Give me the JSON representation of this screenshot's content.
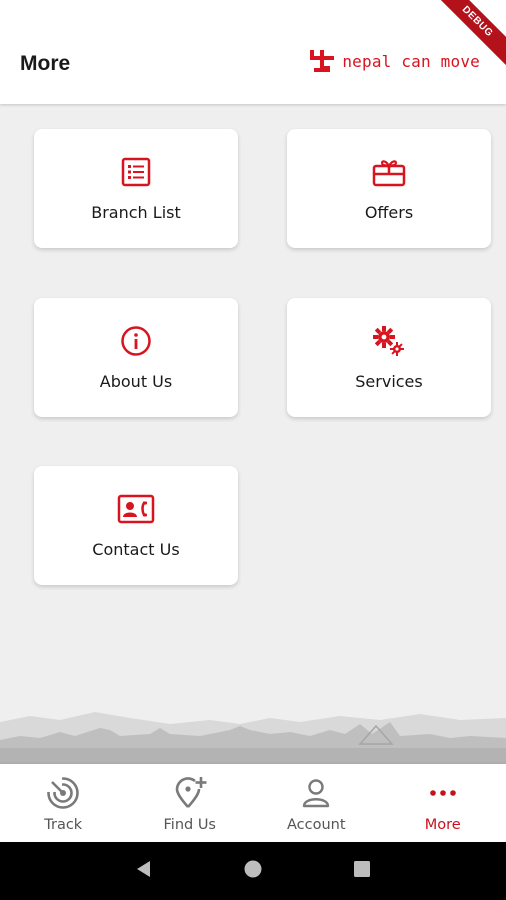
{
  "appbar": {
    "title": "More",
    "brand_text": "nepal can move",
    "debug_label": "DEBUG"
  },
  "colors": {
    "accent": "#d7141f",
    "background": "#efefef",
    "card": "#ffffff",
    "nav_inactive": "#555555"
  },
  "menu": {
    "items": [
      {
        "label": "Branch List",
        "icon": "list-icon"
      },
      {
        "label": "Offers",
        "icon": "gift-icon"
      },
      {
        "label": "About Us",
        "icon": "info-icon"
      },
      {
        "label": "Services",
        "icon": "gears-icon"
      },
      {
        "label": "Contact Us",
        "icon": "contact-card-icon"
      }
    ]
  },
  "bottom_nav": {
    "items": [
      {
        "label": "Track",
        "icon": "track-icon",
        "active": false
      },
      {
        "label": "Find Us",
        "icon": "location-add-icon",
        "active": false
      },
      {
        "label": "Account",
        "icon": "person-icon",
        "active": false
      },
      {
        "label": "More",
        "icon": "more-dots-icon",
        "active": true
      }
    ]
  },
  "system_nav": {
    "buttons": [
      "back-icon",
      "home-icon",
      "recents-icon"
    ]
  }
}
